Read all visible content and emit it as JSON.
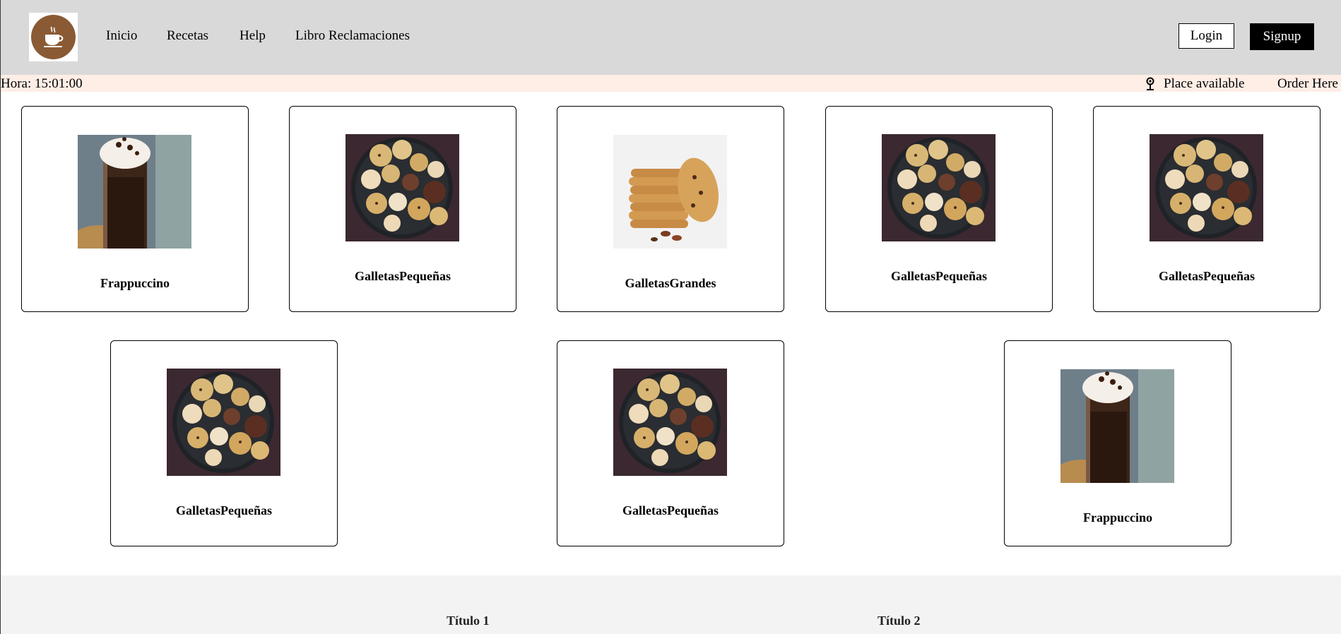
{
  "header": {
    "logo_alt": "coffee-cup-logo",
    "nav": [
      "Inicio",
      "Recetas",
      "Help",
      "Libro Reclamaciones"
    ],
    "login_label": "Login",
    "signup_label": "Signup"
  },
  "infobar": {
    "hora": "Hora: 15:01:00",
    "place": "Place available",
    "order": "Order Here"
  },
  "products": [
    {
      "name": "Frappuccino",
      "image": "frappuccino"
    },
    {
      "name": "GalletasPequeñas",
      "image": "small-cookies"
    },
    {
      "name": "GalletasGrandes",
      "image": "large-cookies"
    },
    {
      "name": "GalletasPequeñas",
      "image": "small-cookies"
    },
    {
      "name": "GalletasPequeñas",
      "image": "small-cookies"
    },
    {
      "name": "GalletasPequeñas",
      "image": "small-cookies"
    },
    {
      "name": "GalletasPequeñas",
      "image": "small-cookies"
    },
    {
      "name": "Frappuccino",
      "image": "frappuccino"
    }
  ],
  "footer": {
    "titles": [
      "Título 1",
      "Título 2"
    ]
  },
  "colors": {
    "header_bg": "#d9d9d9",
    "infobar_bg": "#ffeee6",
    "logo_brown": "#8a5a34",
    "footer_bg": "#f3f3f3"
  }
}
